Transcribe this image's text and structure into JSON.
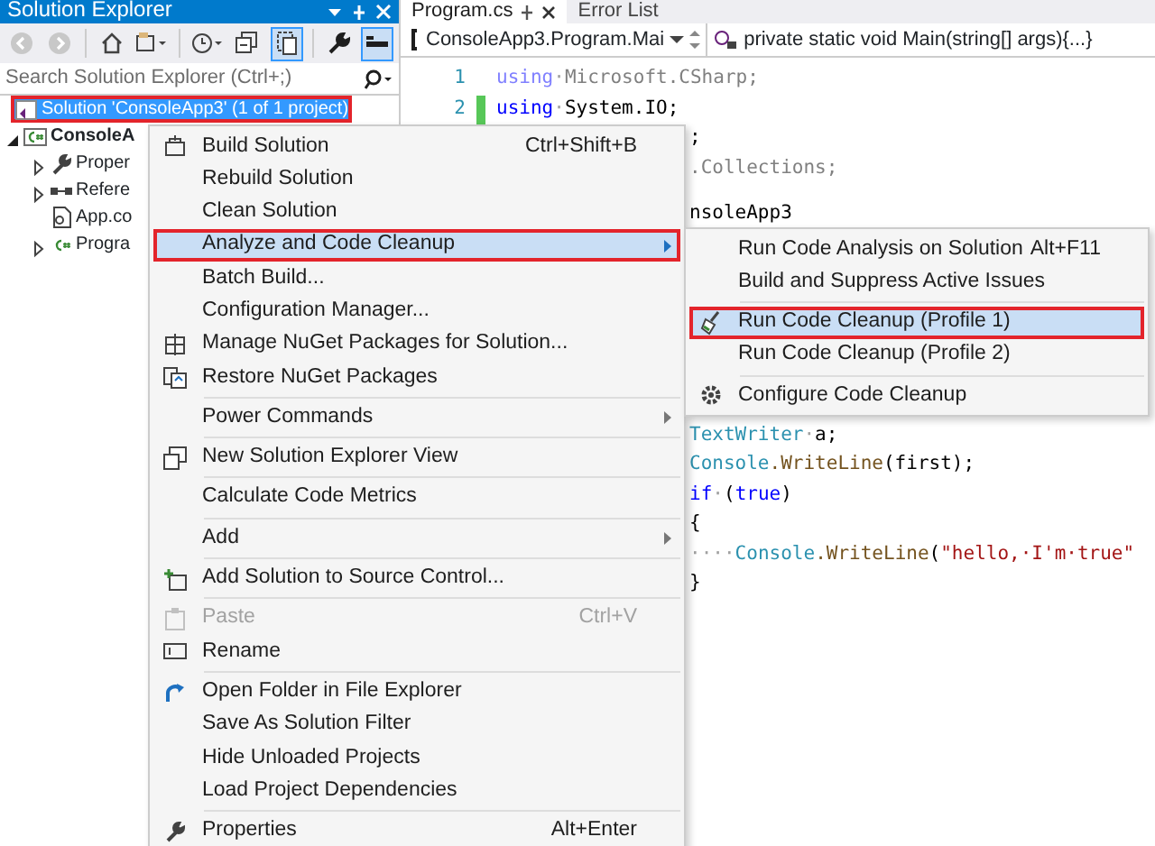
{
  "solution_explorer": {
    "title": "Solution Explorer",
    "toolbar": [
      {
        "pressed": false
      },
      {
        "pressed": false
      },
      {
        "pressed": false
      },
      {
        "pressed": false
      },
      {
        "pressed": false
      },
      {
        "pressed": false
      },
      {
        "pressed": true
      },
      {
        "pressed": false
      },
      {
        "pressed": true
      }
    ],
    "search": {
      "placeholder": "Search Solution Explorer (Ctrl+;)"
    },
    "tree": [
      {
        "label": "Solution 'ConsoleApp3' (1 of 1 project)",
        "selected": true,
        "annotated": true,
        "children": [
          {
            "label": "ConsoleA",
            "kind": "node",
            "expanded": true,
            "selected": false,
            "annotated": false,
            "children": [
              {
                "label": "Proper",
                "kind": "node",
                "expanded": false,
                "selected": false,
                "annotated": false
              },
              {
                "label": "Refere",
                "kind": "node",
                "expanded": false,
                "selected": false,
                "annotated": false
              },
              {
                "label": "App.co",
                "kind": "leaf",
                "selected": false,
                "annotated": false
              },
              {
                "label": "Progra",
                "kind": "node",
                "expanded": false,
                "selected": false,
                "annotated": false
              }
            ]
          }
        ]
      }
    ]
  },
  "editor": {
    "tabs": [
      {
        "label": "Program.cs",
        "selected": true
      },
      {
        "label": "Error List",
        "selected": false
      }
    ],
    "nav": {
      "type": "ConsoleApp3.Program.Mai",
      "member": "private static void Main(string[] args){...}"
    },
    "code_blocks": [
      [
        {
          "number": "1",
          "changed": false,
          "covered": false,
          "segments": [
            {
              "kind": "kwfaded",
              "text": "using"
            },
            {
              "kind": "ws",
              "text": "·"
            },
            {
              "kind": "faded",
              "text": "Microsoft.CSharp;"
            }
          ]
        },
        {
          "number": "2",
          "changed": true,
          "covered": false,
          "segments": [
            {
              "kind": "kw",
              "text": "using"
            },
            {
              "kind": "ws",
              "text": "·"
            },
            {
              "kind": "plain",
              "text": "System.IO;"
            }
          ]
        },
        {
          "covered": true,
          "segments": [
            {
              "kind": "plain",
              "text": ";"
            }
          ]
        },
        {
          "covered": true,
          "segments": [
            {
              "kind": "faded",
              "text": ".Collections;"
            }
          ]
        }
      ],
      [
        {
          "covered": true,
          "segments": [
            {
              "kind": "plain",
              "text": "nsoleApp3"
            }
          ]
        }
      ],
      [
        {
          "covered": true,
          "segments": [
            {
              "kind": "type",
              "text": "TextWriter"
            },
            {
              "kind": "ws",
              "text": "·"
            },
            {
              "kind": "plain",
              "text": "a;"
            }
          ]
        },
        {
          "covered": true,
          "segments": [
            {
              "kind": "type",
              "text": "Console"
            },
            {
              "kind": "method",
              "text": ".WriteLine"
            },
            {
              "kind": "plain",
              "text": "(first);"
            }
          ]
        },
        {
          "covered": true,
          "segments": [
            {
              "kind": "kw",
              "text": "if"
            },
            {
              "kind": "ws",
              "text": "·"
            },
            {
              "kind": "plain",
              "text": "("
            },
            {
              "kind": "kw",
              "text": "true"
            },
            {
              "kind": "plain",
              "text": ")"
            }
          ]
        },
        {
          "covered": true,
          "segments": [
            {
              "kind": "plain",
              "text": "{"
            }
          ]
        },
        {
          "covered": true,
          "segments": [
            {
              "kind": "ws",
              "text": "····"
            },
            {
              "kind": "type",
              "text": "Console"
            },
            {
              "kind": "method",
              "text": ".WriteLine"
            },
            {
              "kind": "plain",
              "text": "("
            },
            {
              "kind": "str",
              "text": "\"hello,·I'm·true\""
            }
          ]
        },
        {
          "covered": true,
          "segments": [
            {
              "kind": "plain",
              "text": "}"
            }
          ]
        }
      ]
    ]
  },
  "context_menu": {
    "items": [
      {
        "kind": "item",
        "label": "Build Solution",
        "shortcut": "Ctrl+Shift+B",
        "selected": false,
        "disabled": false,
        "has_submenu": false,
        "annotated": false
      },
      {
        "kind": "item",
        "label": "Rebuild Solution",
        "selected": false,
        "disabled": false,
        "has_submenu": false,
        "annotated": false
      },
      {
        "kind": "item",
        "label": "Clean Solution",
        "selected": false,
        "disabled": false,
        "has_submenu": false,
        "annotated": false
      },
      {
        "kind": "item",
        "label": "Analyze and Code Cleanup",
        "selected": true,
        "disabled": false,
        "has_submenu": true,
        "annotated": true
      },
      {
        "kind": "item",
        "label": "Batch Build...",
        "selected": false,
        "disabled": false,
        "has_submenu": false,
        "annotated": false
      },
      {
        "kind": "item",
        "label": "Configuration Manager...",
        "selected": false,
        "disabled": false,
        "has_submenu": false,
        "annotated": false
      },
      {
        "kind": "item",
        "label": "Manage NuGet Packages for Solution...",
        "selected": false,
        "disabled": false,
        "has_submenu": false,
        "annotated": false
      },
      {
        "kind": "item",
        "label": "Restore NuGet Packages",
        "selected": false,
        "disabled": false,
        "has_submenu": false,
        "annotated": false
      },
      {
        "kind": "separator"
      },
      {
        "kind": "item",
        "label": "Power Commands",
        "selected": false,
        "disabled": false,
        "has_submenu": true,
        "annotated": false
      },
      {
        "kind": "separator"
      },
      {
        "kind": "item",
        "label": "New Solution Explorer View",
        "selected": false,
        "disabled": false,
        "has_submenu": false,
        "annotated": false
      },
      {
        "kind": "separator"
      },
      {
        "kind": "item",
        "label": "Calculate Code Metrics",
        "selected": false,
        "disabled": false,
        "has_submenu": false,
        "annotated": false
      },
      {
        "kind": "separator"
      },
      {
        "kind": "item",
        "label": "Add",
        "selected": false,
        "disabled": false,
        "has_submenu": true,
        "annotated": false
      },
      {
        "kind": "separator"
      },
      {
        "kind": "item",
        "label": "Add Solution to Source Control...",
        "selected": false,
        "disabled": false,
        "has_submenu": false,
        "annotated": false
      },
      {
        "kind": "separator"
      },
      {
        "kind": "item",
        "label": "Paste",
        "shortcut": "Ctrl+V",
        "selected": false,
        "disabled": true,
        "has_submenu": false,
        "annotated": false
      },
      {
        "kind": "item",
        "label": "Rename",
        "selected": false,
        "disabled": false,
        "has_submenu": false,
        "annotated": false
      },
      {
        "kind": "separator"
      },
      {
        "kind": "item",
        "label": "Open Folder in File Explorer",
        "selected": false,
        "disabled": false,
        "has_submenu": false,
        "annotated": false
      },
      {
        "kind": "item",
        "label": "Save As Solution Filter",
        "selected": false,
        "disabled": false,
        "has_submenu": false,
        "annotated": false
      },
      {
        "kind": "item",
        "label": "Hide Unloaded Projects",
        "selected": false,
        "disabled": false,
        "has_submenu": false,
        "annotated": false
      },
      {
        "kind": "item",
        "label": "Load Project Dependencies",
        "selected": false,
        "disabled": false,
        "has_submenu": false,
        "annotated": false
      },
      {
        "kind": "separator"
      },
      {
        "kind": "item",
        "label": "Properties",
        "shortcut": "Alt+Enter",
        "selected": false,
        "disabled": false,
        "has_submenu": false,
        "annotated": false
      }
    ]
  },
  "submenu": {
    "items": [
      {
        "kind": "item",
        "label": "Run Code Analysis on Solution",
        "shortcut": "Alt+F11",
        "selected": false,
        "disabled": false,
        "has_submenu": false,
        "annotated": false
      },
      {
        "kind": "item",
        "label": "Build and Suppress Active Issues",
        "selected": false,
        "disabled": false,
        "has_submenu": false,
        "annotated": false
      },
      {
        "kind": "separator"
      },
      {
        "kind": "item",
        "label": "Run Code Cleanup (Profile 1)",
        "selected": true,
        "disabled": false,
        "has_submenu": false,
        "annotated": true
      },
      {
        "kind": "item",
        "label": "Run Code Cleanup (Profile 2)",
        "selected": false,
        "disabled": false,
        "has_submenu": false,
        "annotated": false
      },
      {
        "kind": "separator"
      },
      {
        "kind": "item",
        "label": "Configure Code Cleanup",
        "selected": false,
        "disabled": false,
        "has_submenu": false,
        "annotated": false
      }
    ]
  }
}
